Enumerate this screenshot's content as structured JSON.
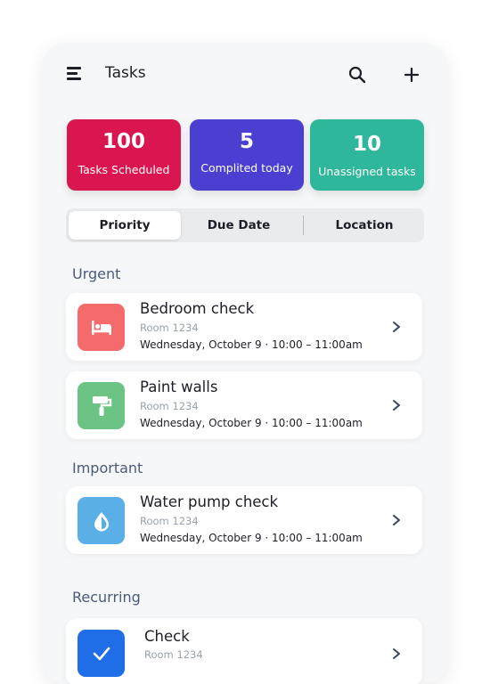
{
  "header": {
    "title": "Tasks"
  },
  "stats": [
    {
      "value": "100",
      "label": "Tasks Scheduled",
      "color": "#d9164f"
    },
    {
      "value": "5",
      "label": "Complited today",
      "color": "#4a3fd0"
    },
    {
      "value": "10",
      "label": "Unassigned tasks",
      "color": "#2fb79b"
    }
  ],
  "tabs": [
    {
      "label": "Priority",
      "active": true
    },
    {
      "label": "Due Date",
      "active": false
    },
    {
      "label": "Location",
      "active": false
    }
  ],
  "sections": {
    "urgent": "Urgent",
    "important": "Important",
    "recurring": "Recurring"
  },
  "tasks": [
    {
      "title": "Bedroom check",
      "room": "Room 1234",
      "time": "Wednesday, October 9 · 10:00 – 11:00am",
      "icon": "bed-icon",
      "color": "#f56b6b"
    },
    {
      "title": "Paint walls",
      "room": "Room 1234",
      "time": "Wednesday, October 9 · 10:00 – 11:00am",
      "icon": "paint-roller-icon",
      "color": "#6cc484"
    },
    {
      "title": "Water pump check",
      "room": "Room 1234",
      "time": "Wednesday, October 9 · 10:00 – 11:00am",
      "icon": "water-drop-icon",
      "color": "#5ab0e6"
    },
    {
      "title": "Check",
      "room": "Room 1234",
      "time": "",
      "icon": "checkmark-icon",
      "color": "#1f6ee8"
    }
  ]
}
